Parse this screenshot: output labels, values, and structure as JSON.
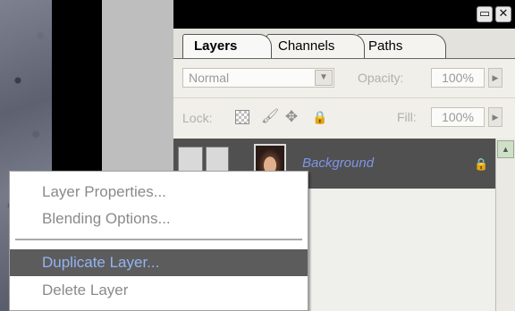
{
  "window": {
    "minimize_glyph": "▭",
    "close_glyph": "✕"
  },
  "tabs": [
    {
      "label": "Layers",
      "active": true
    },
    {
      "label": "Channels",
      "active": false
    },
    {
      "label": "Paths",
      "active": false
    }
  ],
  "palette_menu_icon": "▶",
  "blend": {
    "mode": "Normal",
    "dropdown_arrow": "▼"
  },
  "opacity": {
    "label": "Opacity:",
    "value": "100%",
    "arrow": "▶"
  },
  "lock": {
    "label": "Lock:",
    "icons": {
      "transparency": "checker-icon",
      "image": "brush-icon",
      "position": "move-icon",
      "all": "padlock-icon"
    },
    "image_glyph": "🖌",
    "position_glyph": "✥",
    "all_glyph": "🔒"
  },
  "fill": {
    "label": "Fill:",
    "value": "100%",
    "arrow": "▶"
  },
  "layers": [
    {
      "name": "Background",
      "locked": true,
      "lock_glyph": "🔒"
    }
  ],
  "scrollbar": {
    "up_glyph": "▲"
  },
  "context_menu": {
    "items": [
      {
        "label": "Layer Properties...",
        "enabled": false
      },
      {
        "label": "Blending Options...",
        "enabled": false
      },
      {
        "label": "Duplicate Layer...",
        "enabled": true,
        "highlighted": true
      },
      {
        "label": "Delete Layer",
        "enabled": false
      }
    ]
  },
  "colors": {
    "menu_highlight": "#5c5c5c",
    "menu_highlight_text": "#93b3f2",
    "selected_layer_row": "#505050",
    "layer_name_text": "#7e95e6",
    "disabled_text": "#8a8a8a"
  }
}
